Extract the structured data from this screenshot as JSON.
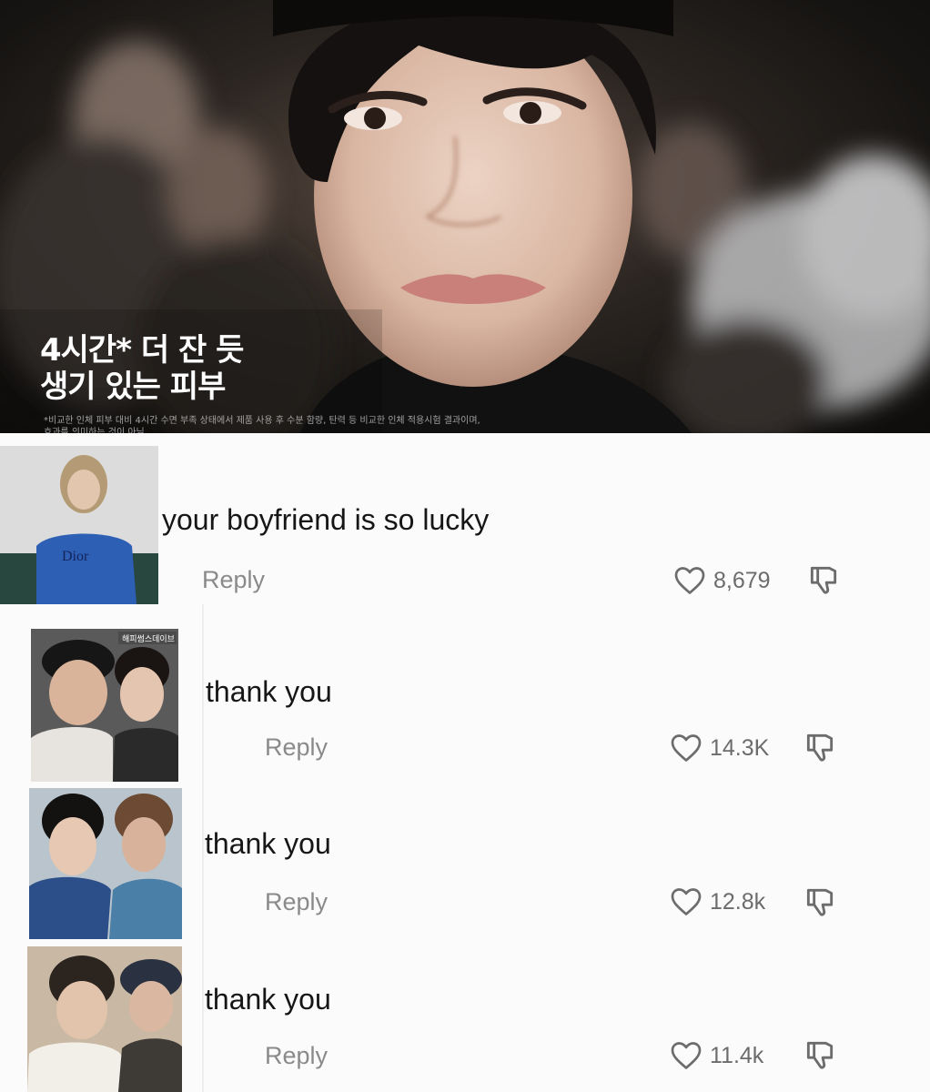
{
  "ad": {
    "headline_line1": "4시간* 더 잔 듯",
    "headline_line2": "생기 있는 피부",
    "fine_print_line1": "*비교한 인체 피부 대비 4시간 수면 부족 상태에서 제품 사용 후 수분 함량, 탄력 등 비교한 인체 적용시험 결과이며,",
    "fine_print_line2": "효과를 의미하는 것이 아님"
  },
  "comments": [
    {
      "text": "your boyfriend is so lucky",
      "reply_label": "Reply",
      "like_count": "8,679",
      "avatar_shirt_text": "Dior"
    },
    {
      "text": "thank you",
      "reply_label": "Reply",
      "like_count": "14.3K",
      "avatar_overlay_text": "해피썸스데이브"
    },
    {
      "text": "thank you",
      "reply_label": "Reply",
      "like_count": "12.8k"
    },
    {
      "text": "thank you",
      "reply_label": "Reply",
      "like_count": "11.4k"
    }
  ],
  "icons": {
    "like": "heart-outline-icon",
    "dislike": "thumbs-down-icon"
  },
  "colors": {
    "background": "#fbfbfb",
    "comment_text": "#161616",
    "reply_text": "#8a8a8a",
    "count_text": "#6c6c6c"
  }
}
